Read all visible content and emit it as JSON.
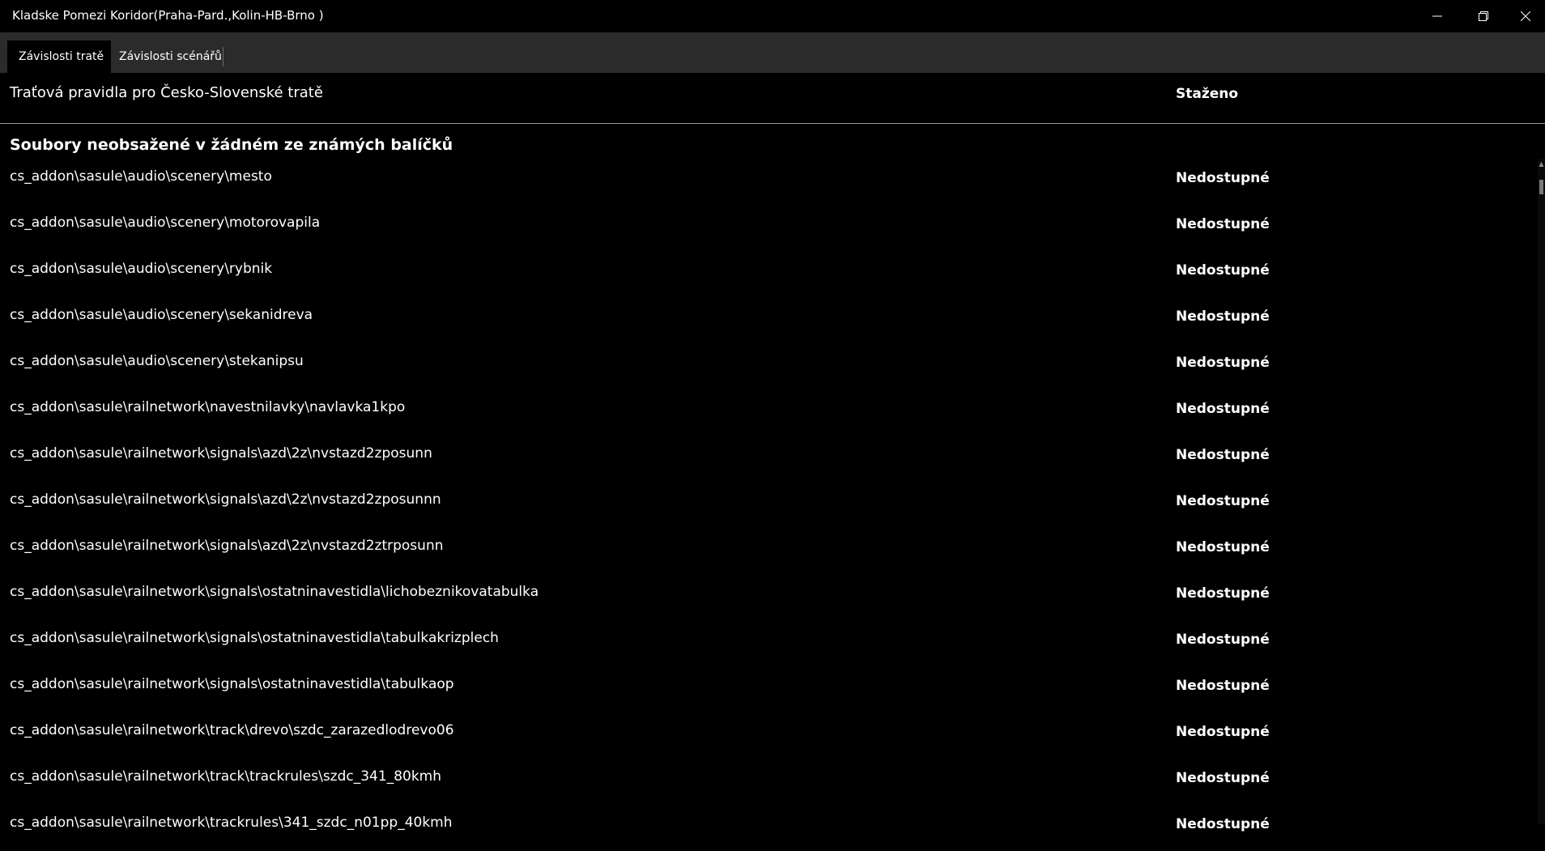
{
  "window": {
    "title": "Kladske Pomezi Koridor(Praha-Pard.,Kolin-HB-Brno )",
    "minimize_icon": "minimize-icon",
    "restore_icon": "restore-icon",
    "close_icon": "close-icon"
  },
  "tabs": [
    {
      "label": "Závislosti tratě",
      "active": true
    },
    {
      "label": "Závislosti scénářů",
      "active": false
    }
  ],
  "header_row": {
    "name": "Traťová pravidla pro Česko-Slovenské tratě",
    "status": "Staženo"
  },
  "section": {
    "title": "Soubory neobsažené v žádném ze známých balíčků"
  },
  "files": [
    {
      "name": "cs_addon\\sasule\\audio\\scenery\\mesto",
      "status": "Nedostupné"
    },
    {
      "name": "cs_addon\\sasule\\audio\\scenery\\motorovapila",
      "status": "Nedostupné"
    },
    {
      "name": "cs_addon\\sasule\\audio\\scenery\\rybnik",
      "status": "Nedostupné"
    },
    {
      "name": "cs_addon\\sasule\\audio\\scenery\\sekanidreva",
      "status": "Nedostupné"
    },
    {
      "name": "cs_addon\\sasule\\audio\\scenery\\stekanipsu",
      "status": "Nedostupné"
    },
    {
      "name": "cs_addon\\sasule\\railnetwork\\navestnilavky\\navlavka1kpo",
      "status": "Nedostupné"
    },
    {
      "name": "cs_addon\\sasule\\railnetwork\\signals\\azd\\2z\\nvstazd2zposunn",
      "status": "Nedostupné"
    },
    {
      "name": "cs_addon\\sasule\\railnetwork\\signals\\azd\\2z\\nvstazd2zposunnn",
      "status": "Nedostupné"
    },
    {
      "name": "cs_addon\\sasule\\railnetwork\\signals\\azd\\2z\\nvstazd2ztrposunn",
      "status": "Nedostupné"
    },
    {
      "name": "cs_addon\\sasule\\railnetwork\\signals\\ostatninavestidla\\lichobeznikovatabulka",
      "status": "Nedostupné"
    },
    {
      "name": "cs_addon\\sasule\\railnetwork\\signals\\ostatninavestidla\\tabulkakrizplech",
      "status": "Nedostupné"
    },
    {
      "name": "cs_addon\\sasule\\railnetwork\\signals\\ostatninavestidla\\tabulkaop",
      "status": "Nedostupné"
    },
    {
      "name": "cs_addon\\sasule\\railnetwork\\track\\drevo\\szdc_zarazedlodrevo06",
      "status": "Nedostupné"
    },
    {
      "name": "cs_addon\\sasule\\railnetwork\\track\\trackrules\\szdc_341_80kmh",
      "status": "Nedostupné"
    },
    {
      "name": "cs_addon\\sasule\\railnetwork\\trackrules\\341_szdc_n01pp_40kmh",
      "status": "Nedostupné"
    }
  ],
  "colors": {
    "background": "#000000",
    "tabbar": "#2b2b2b",
    "text": "#ffffff"
  }
}
